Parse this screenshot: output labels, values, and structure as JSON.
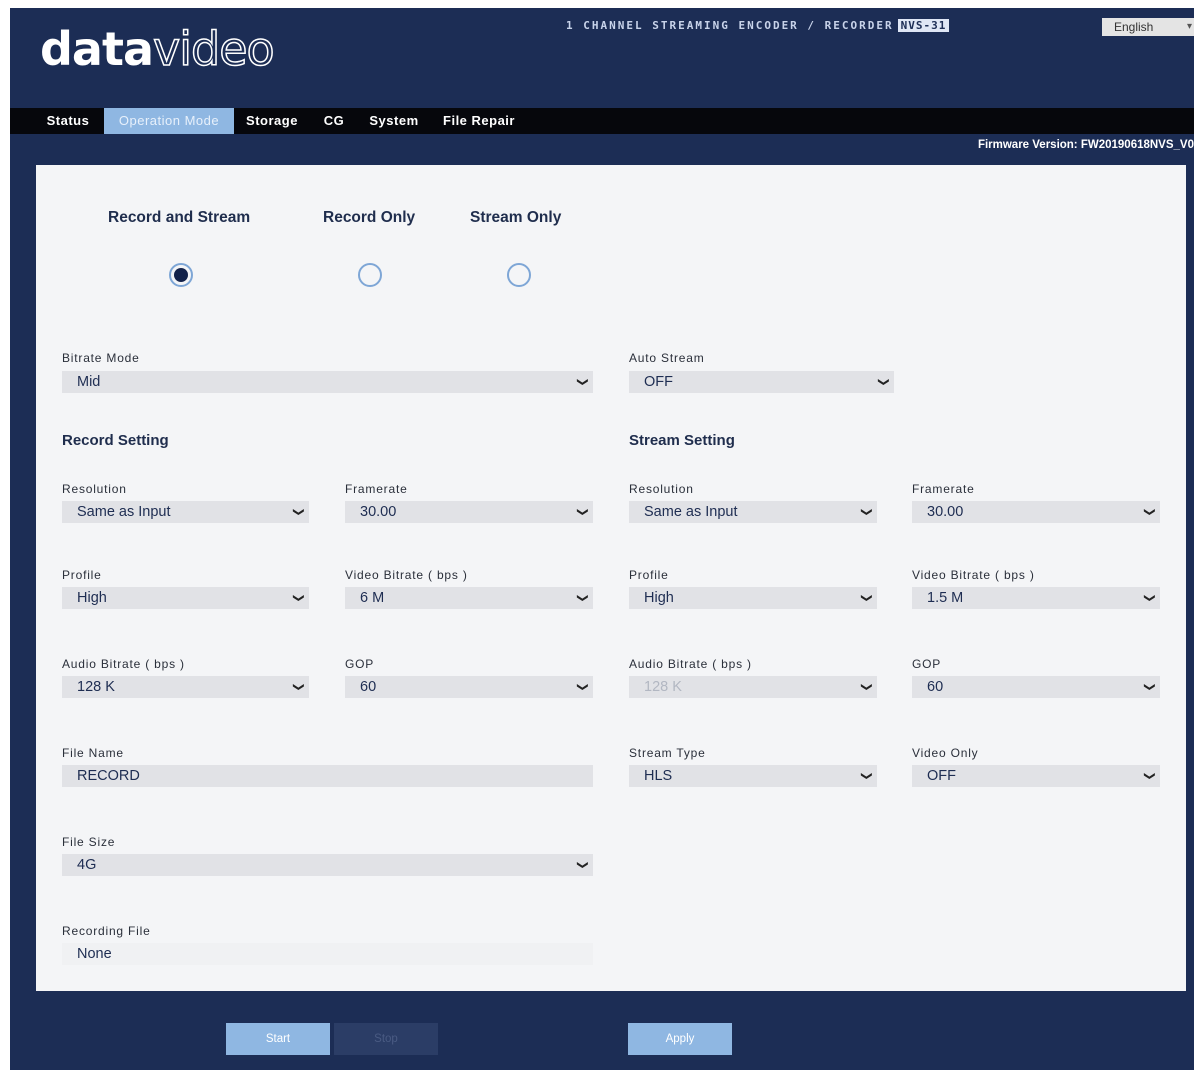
{
  "header": {
    "logo_bold": "data",
    "logo_light": "video",
    "product_title": "1 CHANNEL STREAMING ENCODER / RECORDER",
    "model": "NVS-31",
    "language": "English"
  },
  "nav": {
    "tabs": [
      "Status",
      "Operation Mode",
      "Storage",
      "CG",
      "System",
      "File Repair"
    ],
    "active": "Operation Mode"
  },
  "firmware": "Firmware Version: FW20190618NVS_V0",
  "mode": {
    "options": [
      "Record and Stream",
      "Record Only",
      "Stream Only"
    ],
    "selected": "Record and Stream"
  },
  "top": {
    "bitrate_mode_label": "Bitrate Mode",
    "bitrate_mode_value": "Mid",
    "auto_stream_label": "Auto Stream",
    "auto_stream_value": "OFF"
  },
  "record": {
    "title": "Record Setting",
    "resolution_label": "Resolution",
    "resolution": "Same as Input",
    "framerate_label": "Framerate",
    "framerate": "30.00",
    "profile_label": "Profile",
    "profile": "High",
    "video_bitrate_label": "Video Bitrate ( bps )",
    "video_bitrate": "6 M",
    "audio_bitrate_label": "Audio Bitrate ( bps )",
    "audio_bitrate": "128 K",
    "gop_label": "GOP",
    "gop": "60",
    "file_name_label": "File Name",
    "file_name": "RECORD",
    "file_size_label": "File Size",
    "file_size": "4G",
    "recording_file_label": "Recording File",
    "recording_file": "None"
  },
  "stream": {
    "title": "Stream Setting",
    "resolution_label": "Resolution",
    "resolution": "Same as Input",
    "framerate_label": "Framerate",
    "framerate": "30.00",
    "profile_label": "Profile",
    "profile": "High",
    "video_bitrate_label": "Video Bitrate ( bps )",
    "video_bitrate": "1.5 M",
    "audio_bitrate_label": "Audio Bitrate ( bps )",
    "audio_bitrate": "128 K",
    "gop_label": "GOP",
    "gop": "60",
    "stream_type_label": "Stream Type",
    "stream_type": "HLS",
    "video_only_label": "Video Only",
    "video_only": "OFF"
  },
  "buttons": {
    "start": "Start",
    "stop": "Stop",
    "apply": "Apply"
  },
  "colors": {
    "frame": "#1c2d55",
    "accent": "#8fb7e2",
    "panel": "#f4f5f7",
    "field": "#e1e2e6"
  }
}
